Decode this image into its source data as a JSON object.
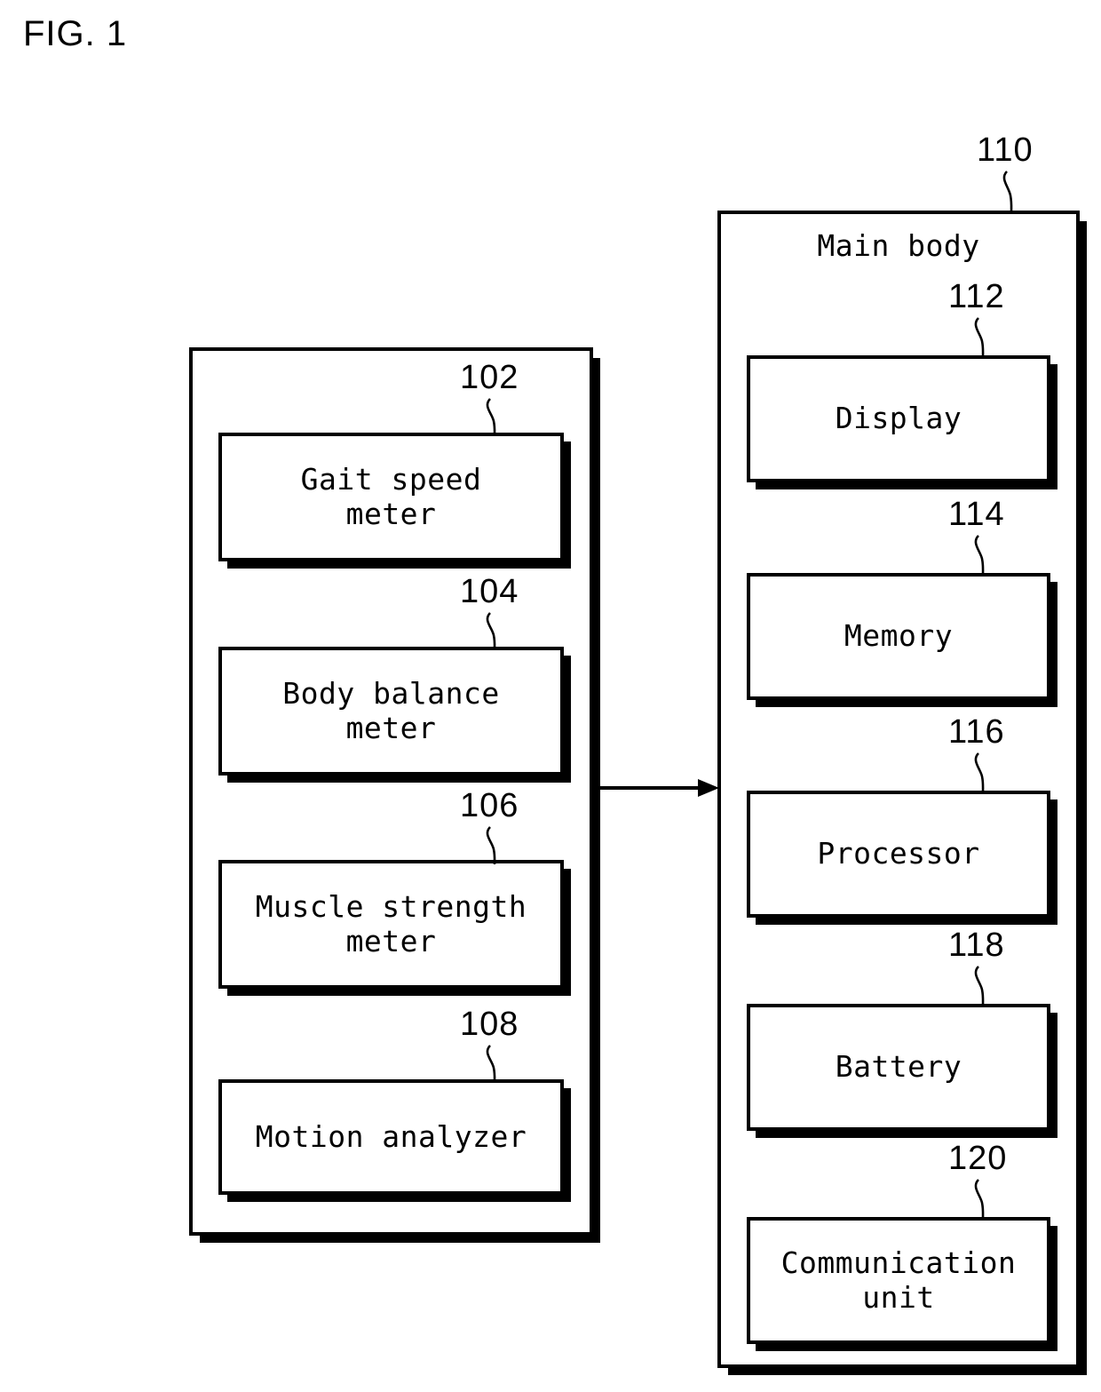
{
  "figure": {
    "title": "FIG. 1"
  },
  "left_panel": {
    "name": "measurement-device-panel",
    "blocks": [
      {
        "ref": "102",
        "label": "Gait speed\nmeter"
      },
      {
        "ref": "104",
        "label": "Body balance\nmeter"
      },
      {
        "ref": "106",
        "label": "Muscle strength\nmeter"
      },
      {
        "ref": "108",
        "label": "Motion analyzer"
      }
    ]
  },
  "right_panel": {
    "ref": "110",
    "caption": "Main body",
    "blocks": [
      {
        "ref": "112",
        "label": "Display"
      },
      {
        "ref": "114",
        "label": "Memory"
      },
      {
        "ref": "116",
        "label": "Processor"
      },
      {
        "ref": "118",
        "label": "Battery"
      },
      {
        "ref": "120",
        "label": "Communication\nunit"
      }
    ]
  },
  "connector": {
    "name": "arrow-left-to-main-body"
  },
  "colors": {
    "stroke": "#000000",
    "background": "#ffffff"
  }
}
